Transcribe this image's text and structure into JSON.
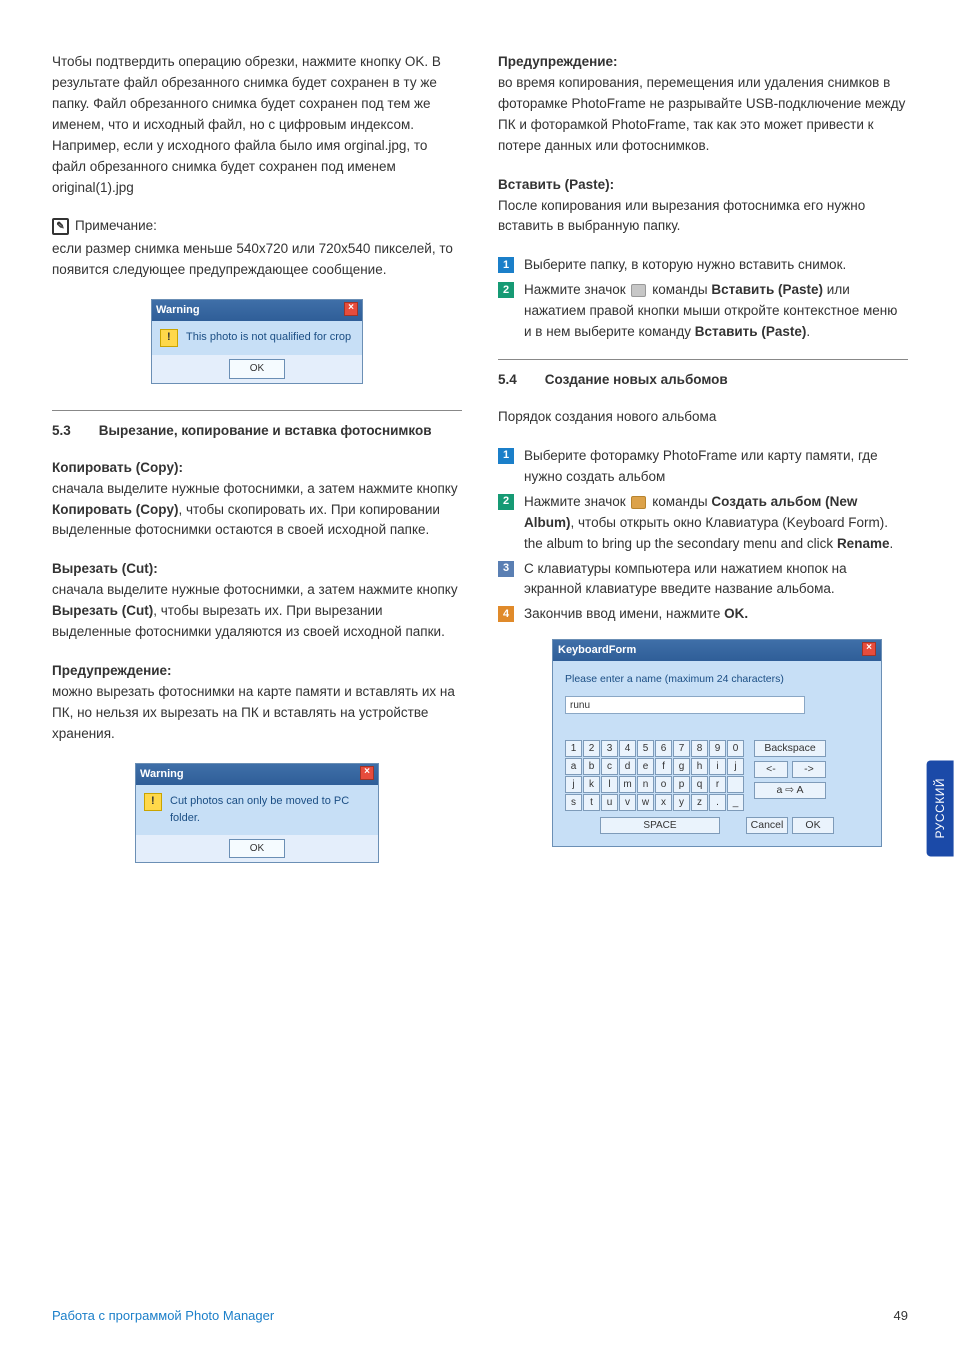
{
  "left": {
    "p1": "Чтобы подтвердить операцию обрезки, нажмите кнопку OK. В результате файл обрезанного снимка будет сохранен в ту же папку. Файл обрезанного снимка будет сохранен под тем же именем, что и исходный файл, но с цифровым индексом. Например, если у исходного файла было имя orginal.jpg, то файл обрезанного снимка будет сохранен под именем original(1).jpg",
    "note_label": "Примечание:",
    "note_body": "если размер снимка меньше 540x720 или 720x540 пикселей, то появится следующее предупреждающее сообщение.",
    "dlg1": {
      "title": "Warning",
      "msg": "This photo is not qualified for crop",
      "ok": "OK"
    },
    "sec_num": "5.3",
    "sec_title": "Вырезание, копирование и вставка фотоснимков",
    "copy_h": "Копировать (Copy):",
    "copy_b1": "сначала выделите нужные фотоснимки, а затем нажмите кнопку ",
    "copy_bold": "Копировать (Copy)",
    "copy_b2": ", чтобы скопировать их. При копировании выделенные фотоснимки остаются в своей исходной папке.",
    "cut_h": "Вырезать (Cut):",
    "cut_b1": "сначала выделите нужные фотоснимки, а затем нажмите кнопку ",
    "cut_bold": "Вырезать (Cut)",
    "cut_b2": ", чтобы вырезать их. При вырезании выделенные фотоснимки удаляются из своей исходной папки.",
    "warn_h": "Предупреждение:",
    "warn_b": "можно вырезать фотоснимки на карте памяти и вставлять их на ПК, но нельзя их вырезать на ПК и вставлять на устройстве хранения.",
    "dlg2": {
      "title": "Warning",
      "msg": "Cut photos can only be moved to PC folder.",
      "ok": "OK"
    }
  },
  "right": {
    "warn_h": "Предупреждение:",
    "warn_b": "во время копирования, перемещения или удаления снимков в фоторамке PhotoFrame не разрывайте USB-подключение между ПК и фоторамкой PhotoFrame, так как это может привести к потере данных или фотоснимков.",
    "paste_h": "Вставить (Paste):",
    "paste_b": "После копирования или вырезания фотоснимка его нужно вставить в выбранную папку.",
    "step1": "Выберите папку, в которую нужно вставить снимок.",
    "step2_a": "Нажмите значок ",
    "step2_b": " команды ",
    "step2_bold1": "Вставить (Paste)",
    "step2_c": " или нажатием правой кнопки мыши откройте контекстное меню и в нем выберите команду ",
    "step2_bold2": "Вставить (Paste)",
    "step2_d": ".",
    "sec_num": "5.4",
    "sec_title": "Создание новых альбомов",
    "intro": "Порядок создания нового альбома",
    "s1": "Выберите фоторамку PhotoFrame или карту памяти, где нужно создать альбом",
    "s2_a": "Нажмите значок ",
    "s2_b": " команды ",
    "s2_bold": "Создать альбом (New Album)",
    "s2_c": ", чтобы открыть окно Клавиатура (Keyboard Form). the album to bring up the secondary menu and click ",
    "s2_bold2": "Rename",
    "s2_d": ".",
    "s3": "С клавиатуры компьютера или нажатием кнопок на экранной клавиатуре введите название альбома.",
    "s4_a": "Закончив ввод имени, нажмите ",
    "s4_bold": "OK.",
    "kb": {
      "title": "KeyboardForm",
      "prompt": "Please enter a name (maximum 24 characters)",
      "value": "runu",
      "row1": [
        "1",
        "2",
        "3",
        "4",
        "5",
        "6",
        "7",
        "8",
        "9",
        "0"
      ],
      "row2": [
        "a",
        "b",
        "c",
        "d",
        "e",
        "f",
        "g",
        "h",
        "i",
        "j"
      ],
      "row3": [
        "j",
        "k",
        "l",
        "m",
        "n",
        "o",
        "p",
        "q",
        "r",
        " "
      ],
      "row4": [
        "s",
        "t",
        "u",
        "v",
        "w",
        "x",
        "y",
        "z",
        ".",
        "_"
      ],
      "space": "SPACE",
      "backspace": "Backspace",
      "left": "<-",
      "right": "->",
      "shift": "a ⇨ A",
      "cancel": "Cancel",
      "ok": "OK"
    }
  },
  "side_tab": "РУССКИЙ",
  "footer_left": "Работа с программой Photo Manager",
  "footer_right": "49"
}
